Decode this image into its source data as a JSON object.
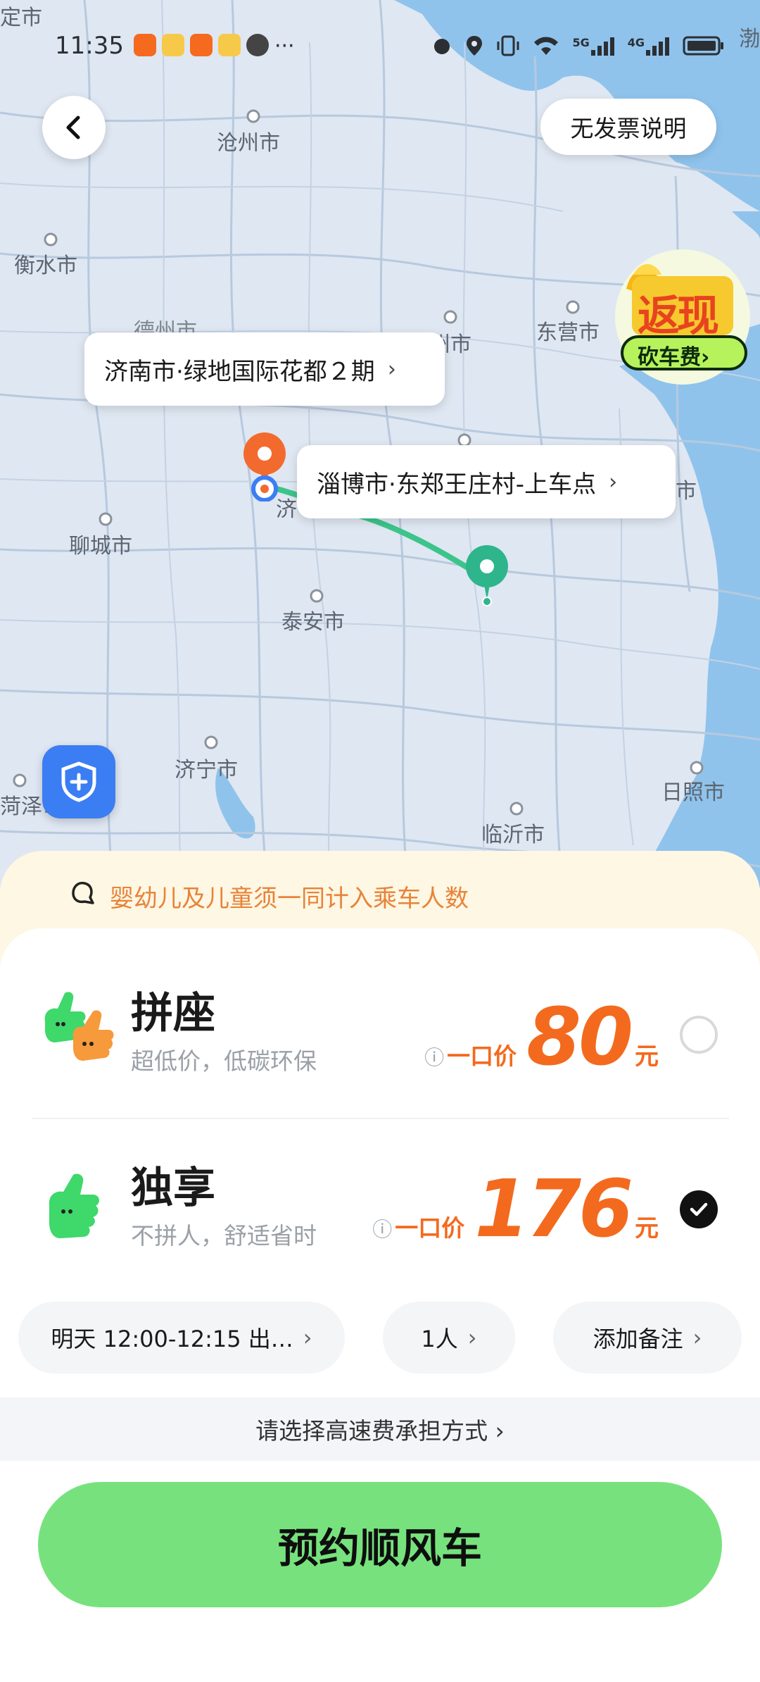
{
  "status": {
    "time": "11:35",
    "dots": "···",
    "net1": "5G",
    "net2": "4G"
  },
  "map": {
    "cities": [
      {
        "id": "shangding",
        "name": "定市"
      },
      {
        "id": "cangzhou",
        "name": "沧州市"
      },
      {
        "id": "hengshui",
        "name": "衡水市"
      },
      {
        "id": "dezhou",
        "name": "德州市"
      },
      {
        "id": "binzhou",
        "name": "滨州市"
      },
      {
        "id": "dongying",
        "name": "东营市"
      },
      {
        "id": "liaocheng",
        "name": "聊城市"
      },
      {
        "id": "taian",
        "name": "泰安市"
      },
      {
        "id": "jining",
        "name": "济宁市"
      },
      {
        "id": "heze",
        "name": "菏泽市"
      },
      {
        "id": "linyi",
        "name": "临沂市"
      },
      {
        "id": "rizhao",
        "name": "日照市"
      },
      {
        "id": "ji",
        "name": "济"
      },
      {
        "id": "weifang",
        "name": "市"
      },
      {
        "id": "bohai",
        "name": "渤"
      }
    ],
    "no_invoice_label": "无发票说明",
    "origin_label": "济南市·绿地国际花都２期",
    "pickup_label": "淄博市·东郑王庄村-上车点",
    "promo_title": "返现",
    "promo_sub": "砍车费",
    "promo_arrow": "›",
    "colors": {
      "route": "#3cc48b",
      "origin_pin": "#f36a2e",
      "dest_pin": "#2fb58c"
    }
  },
  "notice": {
    "text": "婴幼儿及儿童须一同计入乘车人数"
  },
  "options": [
    {
      "title": "拼座",
      "subtitle": "超低价，低碳环保",
      "price_label": "一口价",
      "price": "80",
      "unit": "元",
      "info_icon": "ⓘ",
      "selected": false
    },
    {
      "title": "独享",
      "subtitle": "不拼人，舒适省时",
      "price_label": "一口价",
      "price": "176",
      "unit": "元",
      "info_icon": "ⓘ",
      "selected": true
    }
  ],
  "chips": {
    "time": "明天 12:00-12:15 出…",
    "people": "1人",
    "note": "添加备注"
  },
  "toll": {
    "text": "请选择高速费承担方式 ›"
  },
  "cta": {
    "label": "预约顺风车"
  },
  "accent_colors": {
    "price": "#f36a1e",
    "cta": "#77e27d"
  }
}
